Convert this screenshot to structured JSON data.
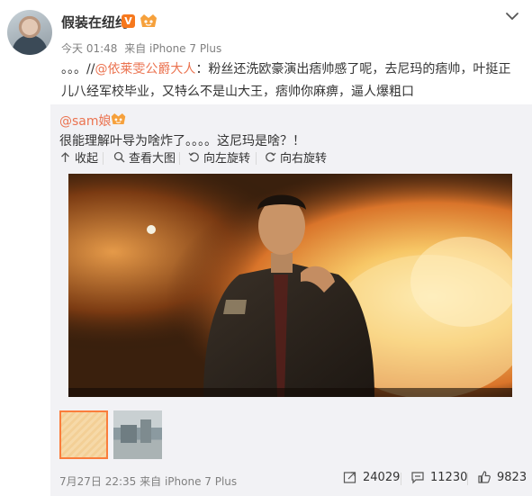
{
  "post": {
    "username": "假装在纽约",
    "verified_badge": "V",
    "timestamp": "今天 01:48",
    "source": "来自 iPhone 7 Plus",
    "text_prefix": "。。。//",
    "mention": "@依莱雯公爵大人",
    "text_line1_rest": "：粉丝还洗欧豪演出痞帅感了呢，去尼玛的痞帅，叶挺",
    "text_line2": "正儿八经军校毕业，又特么不是山大王，痞帅你麻痹，逼人爆粗口"
  },
  "repost": {
    "user": "@sam娘",
    "text": "很能理解叶导为啥炸了。。。。这尼玛是啥？！",
    "toolbar": {
      "collapse": "收起",
      "view_large": "查看大图",
      "rotate_left": "向左旋转",
      "rotate_right": "向右旋转"
    },
    "footer": {
      "timestamp": "7月27日 22:35",
      "source": "来自 iPhone 7 Plus"
    },
    "stats": {
      "reposts": "24029",
      "comments": "11230",
      "likes": "9823"
    }
  },
  "colors": {
    "link": "#eb7350",
    "repost_bg": "#f2f2f5",
    "thumb_selected": "#fa7d3c",
    "vip_orange": "#f6781d"
  },
  "icons": [
    "member-badge-icon",
    "chevron-down-icon",
    "collapse-icon",
    "magnifier-icon",
    "rotate-left-icon",
    "rotate-right-icon",
    "repost-icon",
    "comment-icon",
    "like-icon"
  ]
}
